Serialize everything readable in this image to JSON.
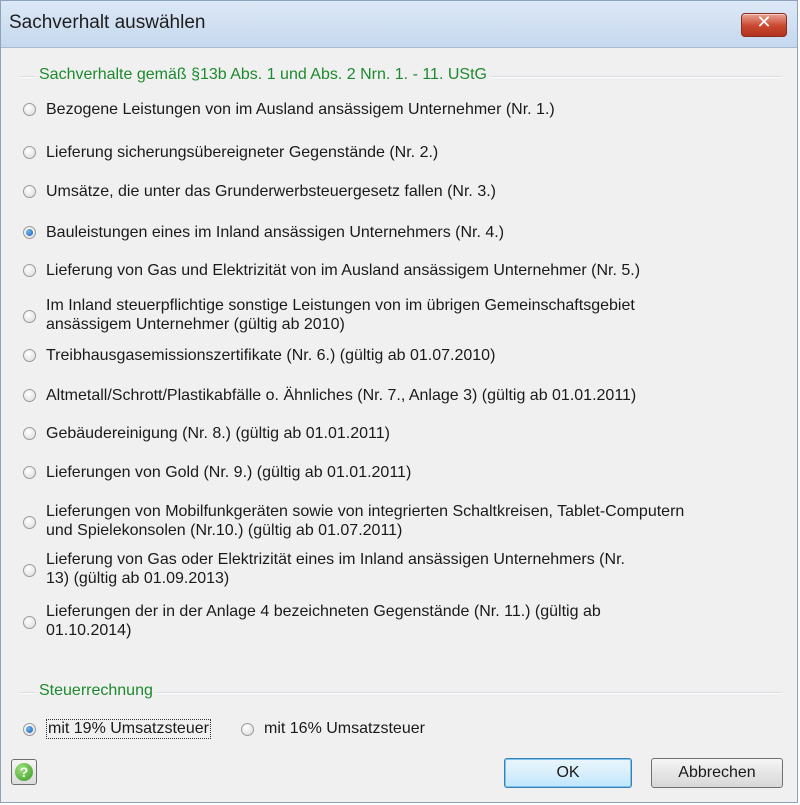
{
  "window": {
    "title": "Sachverhalt auswählen",
    "close_icon": "close-icon",
    "close_color": "#c9462f"
  },
  "group1": {
    "title": "Sachverhalte gemäß §13b Abs. 1 und Abs. 2 Nrn. 1. - 11. UStG",
    "options": [
      {
        "label": "Bezogene Leistungen von im Ausland ansässigem Unternehmer (Nr. 1.)",
        "checked": false
      },
      {
        "label": "Lieferung sicherungsübereigneter Gegenstände (Nr. 2.)",
        "checked": false
      },
      {
        "label": "Umsätze, die unter das Grunderwerbsteuergesetz fallen (Nr. 3.)",
        "checked": false
      },
      {
        "label": "Bauleistungen eines im Inland ansässigen Unternehmers (Nr. 4.)",
        "checked": true
      },
      {
        "label": "Lieferung von Gas und Elektrizität von im Ausland ansässigem Unternehmer (Nr. 5.)",
        "checked": false
      },
      {
        "label": "Im Inland steuerpflichtige sonstige Leistungen von im übrigen Gemeinschaftsgebiet",
        "label2": "ansässigem Unternehmer (gültig ab 2010)",
        "checked": false
      },
      {
        "label": "Treibhausgasemissionszertifikate (Nr. 6.) (gültig ab 01.07.2010)",
        "checked": false
      },
      {
        "label": "Altmetall/Schrott/Plastikabfälle o. Ähnliches (Nr. 7., Anlage 3)  (gültig ab 01.01.2011)",
        "checked": false
      },
      {
        "label": "Gebäudereinigung (Nr. 8.) (gültig ab 01.01.2011)",
        "checked": false
      },
      {
        "label": "Lieferungen von Gold (Nr. 9.) (gültig ab 01.01.2011)",
        "checked": false
      },
      {
        "label": "Lieferungen von Mobilfunkgeräten sowie von integrierten Schaltkreisen, Tablet-Computern",
        "label2": "und Spielekonsolen (Nr.10.) (gültig ab 01.07.2011)",
        "checked": false
      },
      {
        "label": "Lieferung von Gas oder Elektrizität eines im Inland ansässigen Unternehmers (Nr.",
        "label2": "13) (gültig ab 01.09.2013)",
        "checked": false
      },
      {
        "label": "Lieferungen der in der Anlage 4 bezeichneten Gegenstände (Nr. 11.) (gültig ab",
        "label2": "01.10.2014)",
        "checked": false
      }
    ]
  },
  "group2": {
    "title": "Steuerrechnung",
    "option_19": "mit 19% Umsatzsteuer",
    "option_16": "mit 16% Umsatzsteuer",
    "selected": "19"
  },
  "buttons": {
    "help_icon": "help-icon",
    "help_glyph": "?",
    "ok": "OK",
    "cancel": "Abbrechen"
  },
  "colors": {
    "group_title": "#1d8a2e",
    "radio_checked": "#1c5fb0"
  }
}
